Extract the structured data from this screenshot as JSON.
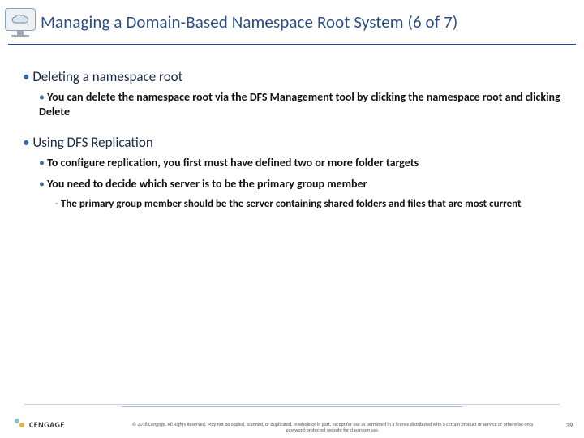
{
  "header": {
    "title": "Managing a Domain-Based Namespace Root System (6 of 7)",
    "icon": "cloud-monitor-icon"
  },
  "body": {
    "sections": [
      {
        "heading": "Deleting a namespace root",
        "points": [
          "You can delete the namespace root via the DFS Management tool by clicking the namespace root and clicking Delete"
        ],
        "subpoints": []
      },
      {
        "heading": "Using DFS Replication",
        "points": [
          "To configure replication, you first must have defined two or more folder targets",
          "You need to decide which server is to be the primary group member"
        ],
        "subpoints": [
          "The primary group member should be the server containing shared folders and files that are most current"
        ]
      }
    ]
  },
  "footer": {
    "brand": "CENGAGE",
    "copyright": "© 2018 Cengage. All Rights Reserved. May not be copied, scanned, or duplicated, in whole or in part, except for use as permitted in a license distributed with a certain product or service or otherwise on a password-protected website for classroom use.",
    "page": "39"
  }
}
